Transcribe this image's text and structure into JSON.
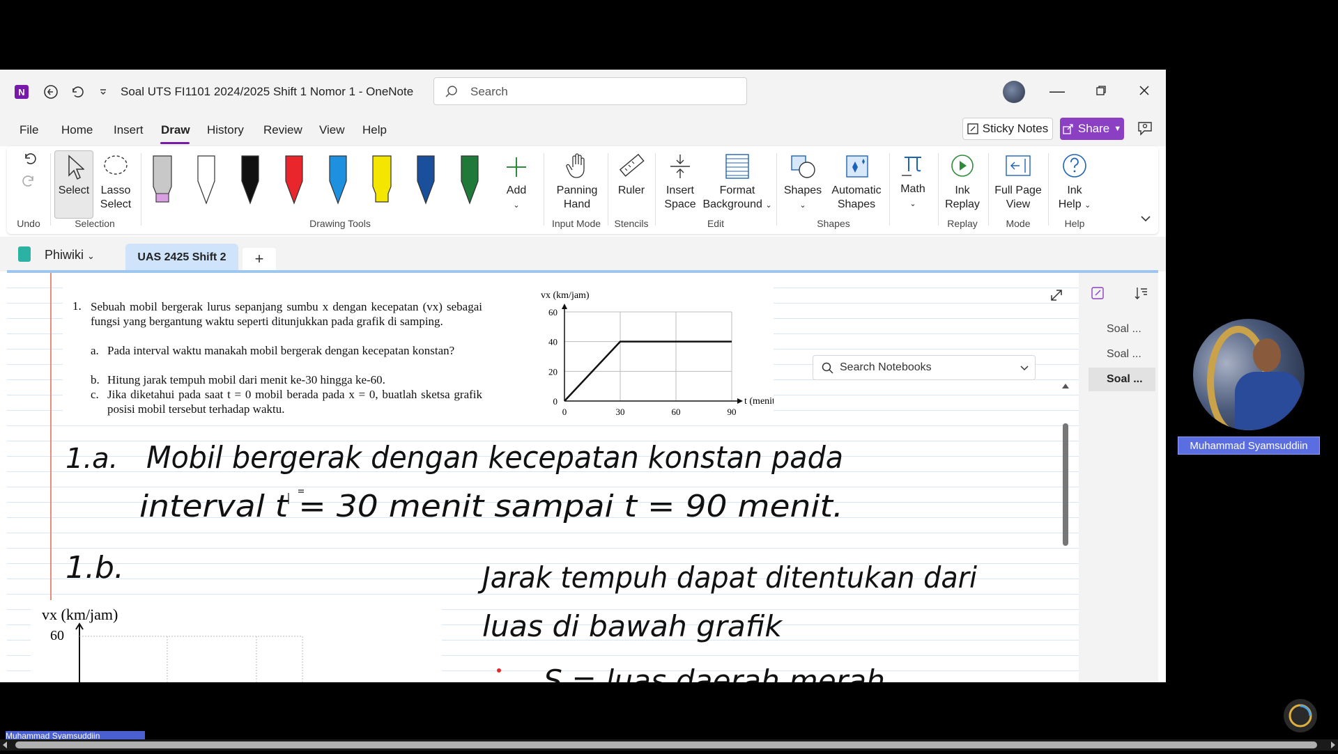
{
  "window": {
    "doc_title": "Soal UTS FI1101 2024/2025 Shift 1 Nomor 1  -  OneNote",
    "search_placeholder": "Search"
  },
  "menu": {
    "items": [
      "File",
      "Home",
      "Insert",
      "Draw",
      "History",
      "Review",
      "View",
      "Help"
    ],
    "active": "Draw",
    "sticky_notes": "Sticky Notes",
    "share": "Share"
  },
  "ribbon": {
    "select": "Select",
    "lasso_line1": "Lasso",
    "lasso_line2": "Select",
    "add": "Add",
    "panning_line1": "Panning",
    "panning_line2": "Hand",
    "ruler": "Ruler",
    "insert_space_line1": "Insert",
    "insert_space_line2": "Space",
    "format_bg_line1": "Format",
    "format_bg_line2": "Background",
    "shapes": "Shapes",
    "auto_shapes_line1": "Automatic",
    "auto_shapes_line2": "Shapes",
    "math": "Math",
    "ink_replay_line1": "Ink",
    "ink_replay_line2": "Replay",
    "full_page_line1": "Full Page",
    "full_page_line2": "View",
    "ink_help_line1": "Ink",
    "ink_help_line2": "Help",
    "groups": {
      "undo": "Undo",
      "selection": "Selection",
      "drawing_tools": "Drawing Tools",
      "input_mode": "Input Mode",
      "stencils": "Stencils",
      "edit": "Edit",
      "shapes": "Shapes",
      "replay": "Replay",
      "mode": "Mode",
      "help": "Help"
    },
    "pen_colors": [
      "#c8c8c8",
      "#ffffff",
      "#111111",
      "#e8262b",
      "#1e90e0",
      "#f5e600",
      "#1a4f9c",
      "#1f7a3a"
    ]
  },
  "notebook": {
    "name": "Phiwiki",
    "section_tab": "UAS 2425 Shift 2",
    "add_tab": "+"
  },
  "page_list": [
    "Soal ...",
    "Soal ...",
    "Soal ..."
  ],
  "search_notebooks": "Search Notebooks",
  "question": {
    "number": "1.",
    "intro": "Sebuah mobil bergerak lurus sepanjang sumbu x dengan kecepatan (vx) sebagai fungsi yang bergantung waktu seperti ditunjukkan pada grafik di samping.",
    "a_label": "a.",
    "a": "Pada interval waktu manakah mobil bergerak dengan kecepatan konstan?",
    "b_label": "b.",
    "b": "Hitung jarak tempuh mobil dari menit ke-30 hingga ke-60.",
    "c_label": "c.",
    "c": "Jika diketahui pada saat t = 0 mobil berada pada x = 0, buatlah sketsa grafik posisi mobil tersebut terhadap waktu."
  },
  "chart_data": {
    "type": "line",
    "ylabel": "vx (km/jam)",
    "xlabel": "t (menit)",
    "x": [
      0,
      30,
      90
    ],
    "y": [
      0,
      40,
      40
    ],
    "xticks": [
      "0",
      "30",
      "60",
      "90"
    ],
    "yticks": [
      "0",
      "20",
      "40",
      "60"
    ],
    "xlim": [
      0,
      90
    ],
    "ylim": [
      0,
      60
    ],
    "grid": true
  },
  "handwriting": {
    "a_label": "1.a.",
    "a_line1": "Mobil bergerak dengan kecepatan konstan pada",
    "a_line2": "interval t = 30 menit sampai t = 90 menit.",
    "b_label": "1.b.",
    "b_line1": "Jarak tempuh dapat ditentukan dari",
    "b_line2": "luas di bawah grafik",
    "b_line3": "S = luas daerah merah"
  },
  "pasted_chart": {
    "ylabel": "vx (km/jam)",
    "ytick": "60"
  },
  "participant": {
    "name": "Muhammad Syamsuddiin"
  },
  "bottom_label": "Muhammad Syamsuddiin"
}
